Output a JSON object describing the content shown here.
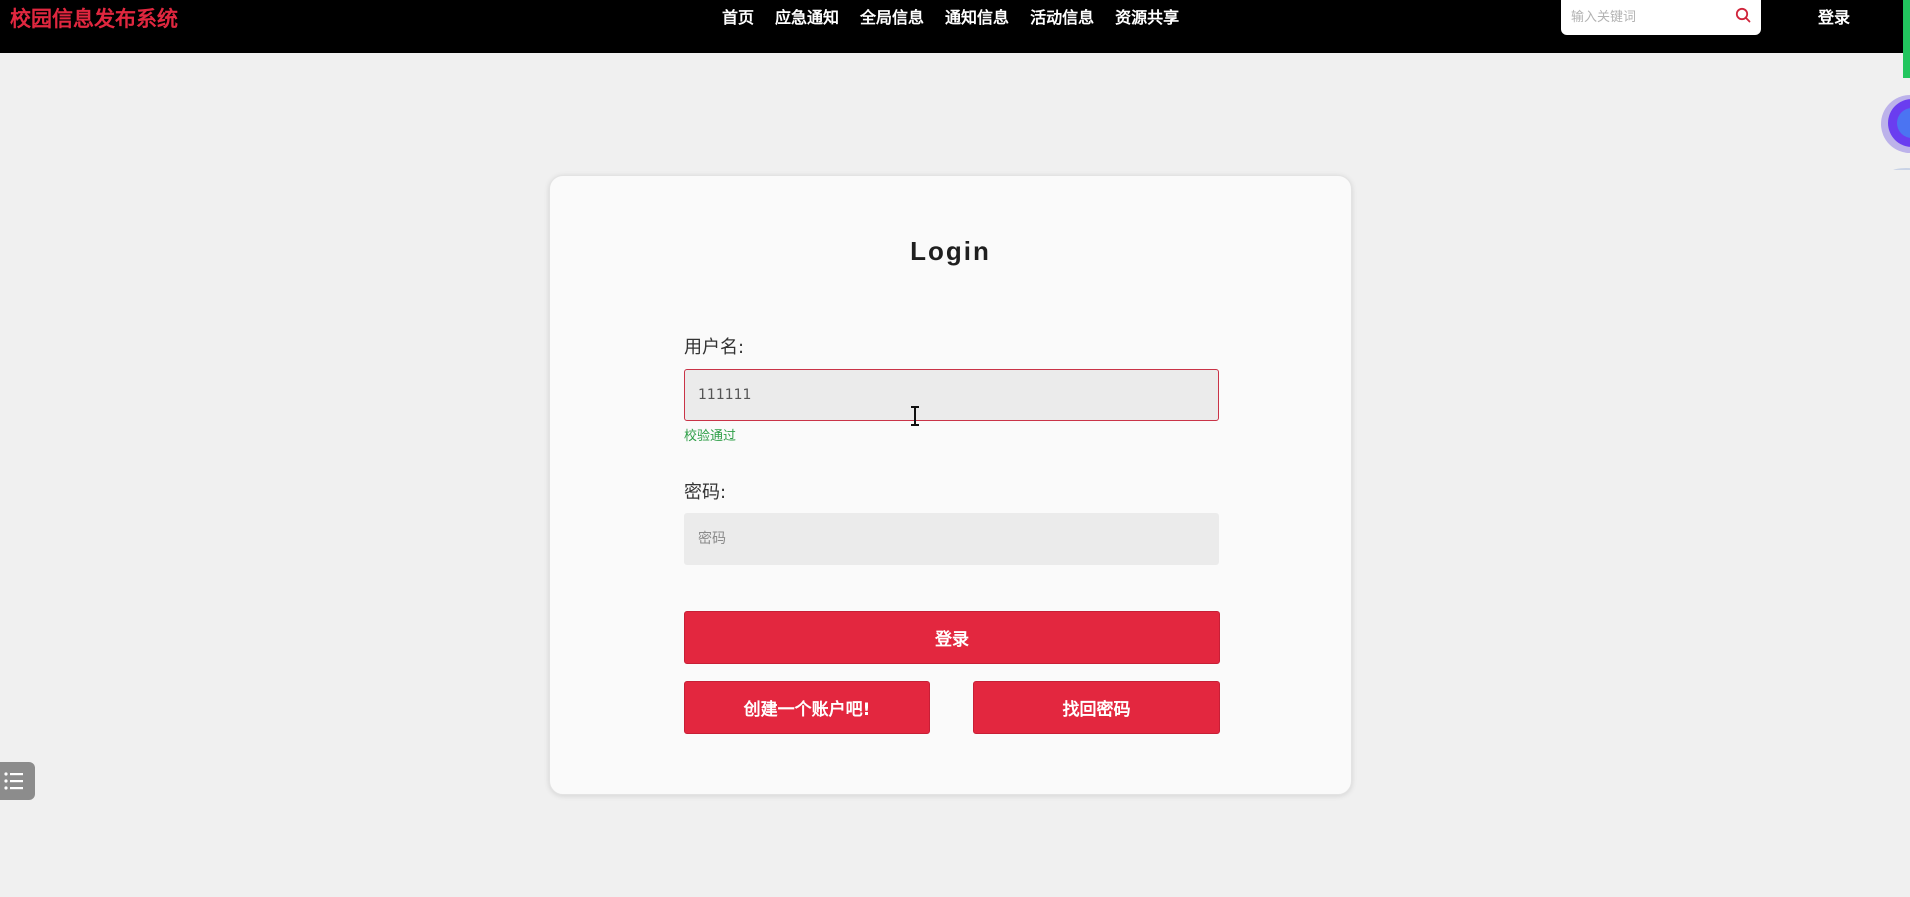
{
  "header": {
    "logo": "校园信息发布系统",
    "nav": [
      "首页",
      "应急通知",
      "全局信息",
      "通知信息",
      "活动信息",
      "资源共享"
    ],
    "search_placeholder": "输入关键词",
    "login_link": "登录"
  },
  "login_card": {
    "title": "Login",
    "username_label": "用户名:",
    "username_value": "111111",
    "username_validation": "校验通过",
    "password_label": "密码:",
    "password_placeholder": "密码",
    "login_button": "登录",
    "create_account_button": "创建一个账户吧!",
    "recover_password_button": "找回密码"
  },
  "colors": {
    "brand_red": "#e3273f",
    "success_green": "#2e9e47",
    "header_bg": "#000000",
    "page_bg": "#f0f0f0"
  },
  "icons": [
    "search-icon",
    "menu-list-icon",
    "text-cursor-icon",
    "assistant-avatar-icon"
  ]
}
